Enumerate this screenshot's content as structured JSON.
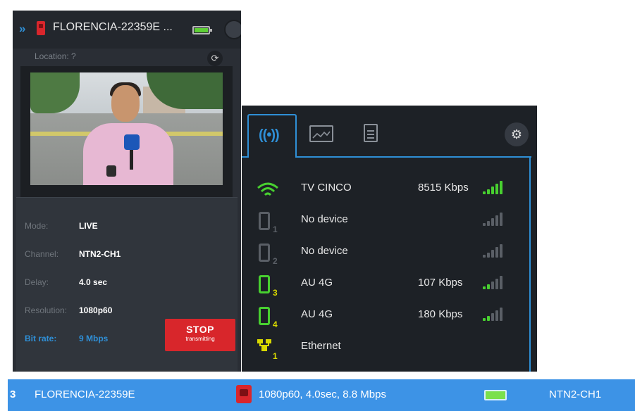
{
  "device": {
    "name": "FLORENCIA-22359E ...",
    "location_label": "Location: ?"
  },
  "info": {
    "mode_label": "Mode:",
    "mode_value": "LIVE",
    "channel_label": "Channel:",
    "channel_value": "NTN2-CH1",
    "delay_label": "Delay:",
    "delay_value": "4.0 sec",
    "resolution_label": "Resolution:",
    "resolution_value": "1080p60",
    "bitrate_label": "Bit rate:",
    "bitrate_value": "9 Mbps"
  },
  "stop_button": {
    "line1": "STOP",
    "line2": "transmitting"
  },
  "tabs": [
    {
      "icon": "antenna-icon",
      "active": true
    },
    {
      "icon": "chart-icon",
      "active": false
    },
    {
      "icon": "document-icon",
      "active": false
    }
  ],
  "connections": [
    {
      "icon": "wifi-icon",
      "index": "",
      "name": "TV CINCO",
      "rate": "8515 Kbps",
      "signal": 5,
      "active": true
    },
    {
      "icon": "phone-icon",
      "index": "1",
      "name": "No device",
      "rate": "",
      "signal": 0,
      "active": false
    },
    {
      "icon": "phone-icon",
      "index": "2",
      "name": "No device",
      "rate": "",
      "signal": 0,
      "active": false
    },
    {
      "icon": "phone-icon",
      "index": "3",
      "name": "AU 4G",
      "rate": "107 Kbps",
      "signal": 2,
      "active": true
    },
    {
      "icon": "phone-icon",
      "index": "4",
      "name": "AU 4G",
      "rate": "180 Kbps",
      "signal": 2,
      "active": true
    },
    {
      "icon": "ethernet-icon",
      "index": "1",
      "name": "Ethernet",
      "rate": "",
      "signal": null,
      "active": true
    }
  ],
  "status_bar": {
    "index": "3",
    "name": "FLORENCIA-22359E",
    "stats": "1080p60, 4.0sec, 8.8 Mbps",
    "channel": "NTN2-CH1"
  },
  "colors": {
    "accent": "#2f8fd6",
    "signal_on": "#48d030",
    "signal_off": "#5a5f66",
    "stop": "#d8262b",
    "status_bar": "#3d93e6"
  }
}
